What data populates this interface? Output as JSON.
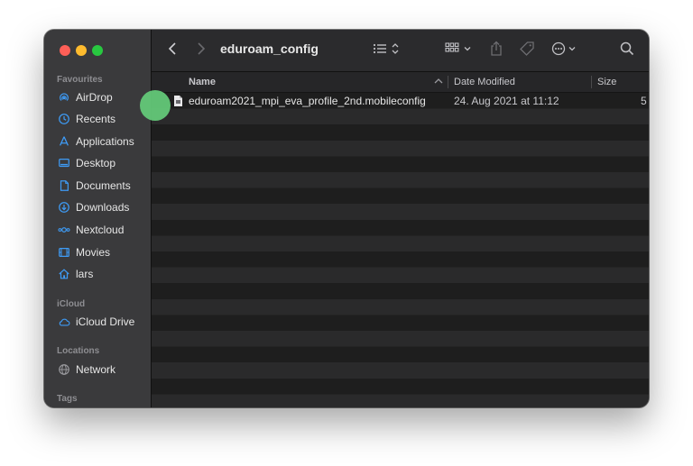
{
  "window": {
    "title": "eduroam_config"
  },
  "colors": {
    "close": "#fe5f57",
    "minimize": "#febb2e",
    "zoom": "#28c840",
    "accent": "#3e9bf5",
    "cursor_dot": "#63c878"
  },
  "sidebar": {
    "favourites_label": "Favourites",
    "favourites": [
      {
        "label": "AirDrop",
        "icon": "airdrop-icon"
      },
      {
        "label": "Recents",
        "icon": "clock-icon"
      },
      {
        "label": "Applications",
        "icon": "applications-icon"
      },
      {
        "label": "Desktop",
        "icon": "desktop-icon"
      },
      {
        "label": "Documents",
        "icon": "document-icon"
      },
      {
        "label": "Downloads",
        "icon": "download-icon"
      },
      {
        "label": "Nextcloud",
        "icon": "nextcloud-icon"
      },
      {
        "label": "Movies",
        "icon": "film-icon"
      },
      {
        "label": "lars",
        "icon": "home-icon"
      }
    ],
    "icloud_label": "iCloud",
    "icloud": [
      {
        "label": "iCloud Drive",
        "icon": "cloud-icon"
      }
    ],
    "locations_label": "Locations",
    "locations": [
      {
        "label": "Network",
        "icon": "globe-icon"
      }
    ],
    "tags_label": "Tags"
  },
  "columns": {
    "name": "Name",
    "date_modified": "Date Modified",
    "size": "Size"
  },
  "files": [
    {
      "name": "eduroam2021_mpi_eva_profile_2nd.mobileconfig",
      "date_modified": "24. Aug 2021 at 11:12",
      "size": "5"
    }
  ]
}
